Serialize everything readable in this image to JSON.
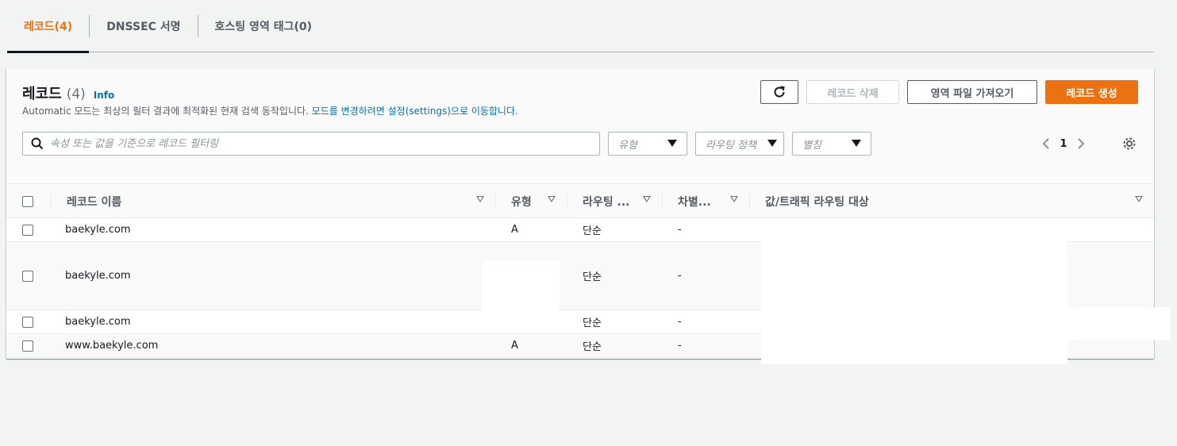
{
  "tabs": [
    {
      "label": "레코드(4)"
    },
    {
      "label": "DNSSEC 서명"
    },
    {
      "label": "호스팅 영역 태그(0)"
    }
  ],
  "panel": {
    "title": "레코드",
    "count": "(4)",
    "info": "Info",
    "desc_prefix": "Automatic 모드는 최상의 필터 결과에 최적화된 현재 검색 동작입니다.",
    "desc_link": "모드를 변경하려면 설정(settings)으로 이동합니다.",
    "buttons": {
      "delete": "레코드 삭제",
      "import": "영역 파일 가져오기",
      "create": "레코드 생성"
    },
    "search_placeholder": "속성 또는 값을 기준으로 레코드 필터링",
    "filters": {
      "type": "유형",
      "routing": "라우팅 정책",
      "alias": "별칭"
    },
    "pager": {
      "page": "1"
    }
  },
  "table": {
    "columns": {
      "name": "레코드 이름",
      "type": "유형",
      "routing": "라우팅 ...",
      "diff": "차별...",
      "value": "값/트래픽 라우팅 대상"
    },
    "rows": [
      {
        "name": "baekyle.com",
        "type": "A",
        "routing": "단순",
        "diff": "-"
      },
      {
        "name": "baekyle.com",
        "type": "",
        "routing": "단순",
        "diff": "-"
      },
      {
        "name": "baekyle.com",
        "type": "",
        "routing": "단순",
        "diff": "-"
      },
      {
        "name": "www.baekyle.com",
        "type": "A",
        "routing": "단순",
        "diff": "-"
      }
    ]
  },
  "colors": {
    "accent": "#ec7211",
    "link": "#0073bb"
  }
}
